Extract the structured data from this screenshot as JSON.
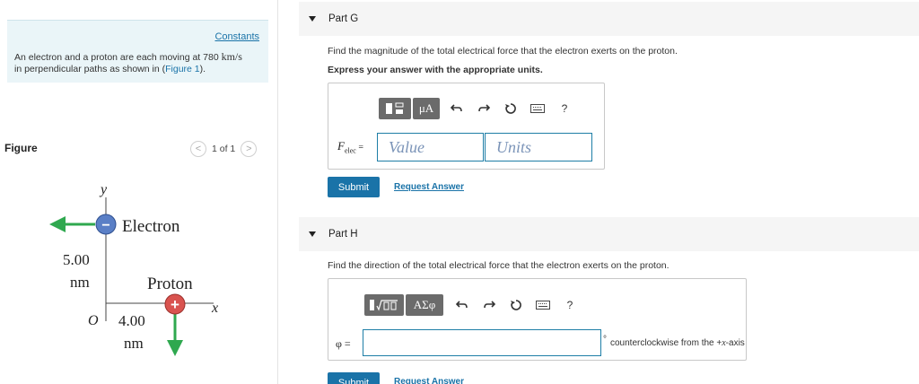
{
  "problem": {
    "constants_link": "Constants",
    "text_part1": "An electron and a proton are each moving at 780 ",
    "unit": "km/s",
    "text_part2": "in perpendicular paths as shown in (",
    "figure_link": "Figure 1",
    "text_part3": ")."
  },
  "figure": {
    "label": "Figure",
    "pager_prev": "<",
    "pager_text": "1 of 1",
    "pager_next": ">",
    "y_axis_label": "y",
    "x_axis_label": "x",
    "origin_label": "O",
    "electron_label": "Electron",
    "proton_label": "Proton",
    "electron_symbol": "−",
    "proton_symbol": "+",
    "vertical_value": "5.00",
    "vertical_unit": "nm",
    "horizontal_value": "4.00",
    "horizontal_unit": "nm",
    "colors": {
      "electron": "#5a7fc6",
      "proton": "#d9534f",
      "arrow": "#2fa84f"
    }
  },
  "partG": {
    "title": "Part G",
    "question": "Find the magnitude of the total electrical force that the electron exerts on the proton.",
    "instruction": "Express your answer with the appropriate units.",
    "toolbar": {
      "templates_icon": "templates-icon",
      "units_label": "μA",
      "help": "?"
    },
    "input_label_main": "F",
    "input_label_sub": "elec",
    "input_label_eq": " =",
    "value_placeholder": "Value",
    "units_placeholder": "Units",
    "submit": "Submit",
    "request": "Request Answer"
  },
  "partH": {
    "title": "Part H",
    "question": "Find the direction of the total electrical force that the electron exerts on the proton.",
    "toolbar": {
      "greek_label": "AΣφ",
      "help": "?"
    },
    "input_label": "φ =",
    "input_value": "",
    "suffix_degree": "°",
    "suffix_text": "counterclockwise from the +",
    "suffix_axis": "x",
    "suffix_end": "-axis",
    "submit": "Submit",
    "request": "Request Answer"
  },
  "colors": {
    "link": "#1a73a8",
    "button": "#1a73a8",
    "input_border": "#1e7ea6"
  }
}
